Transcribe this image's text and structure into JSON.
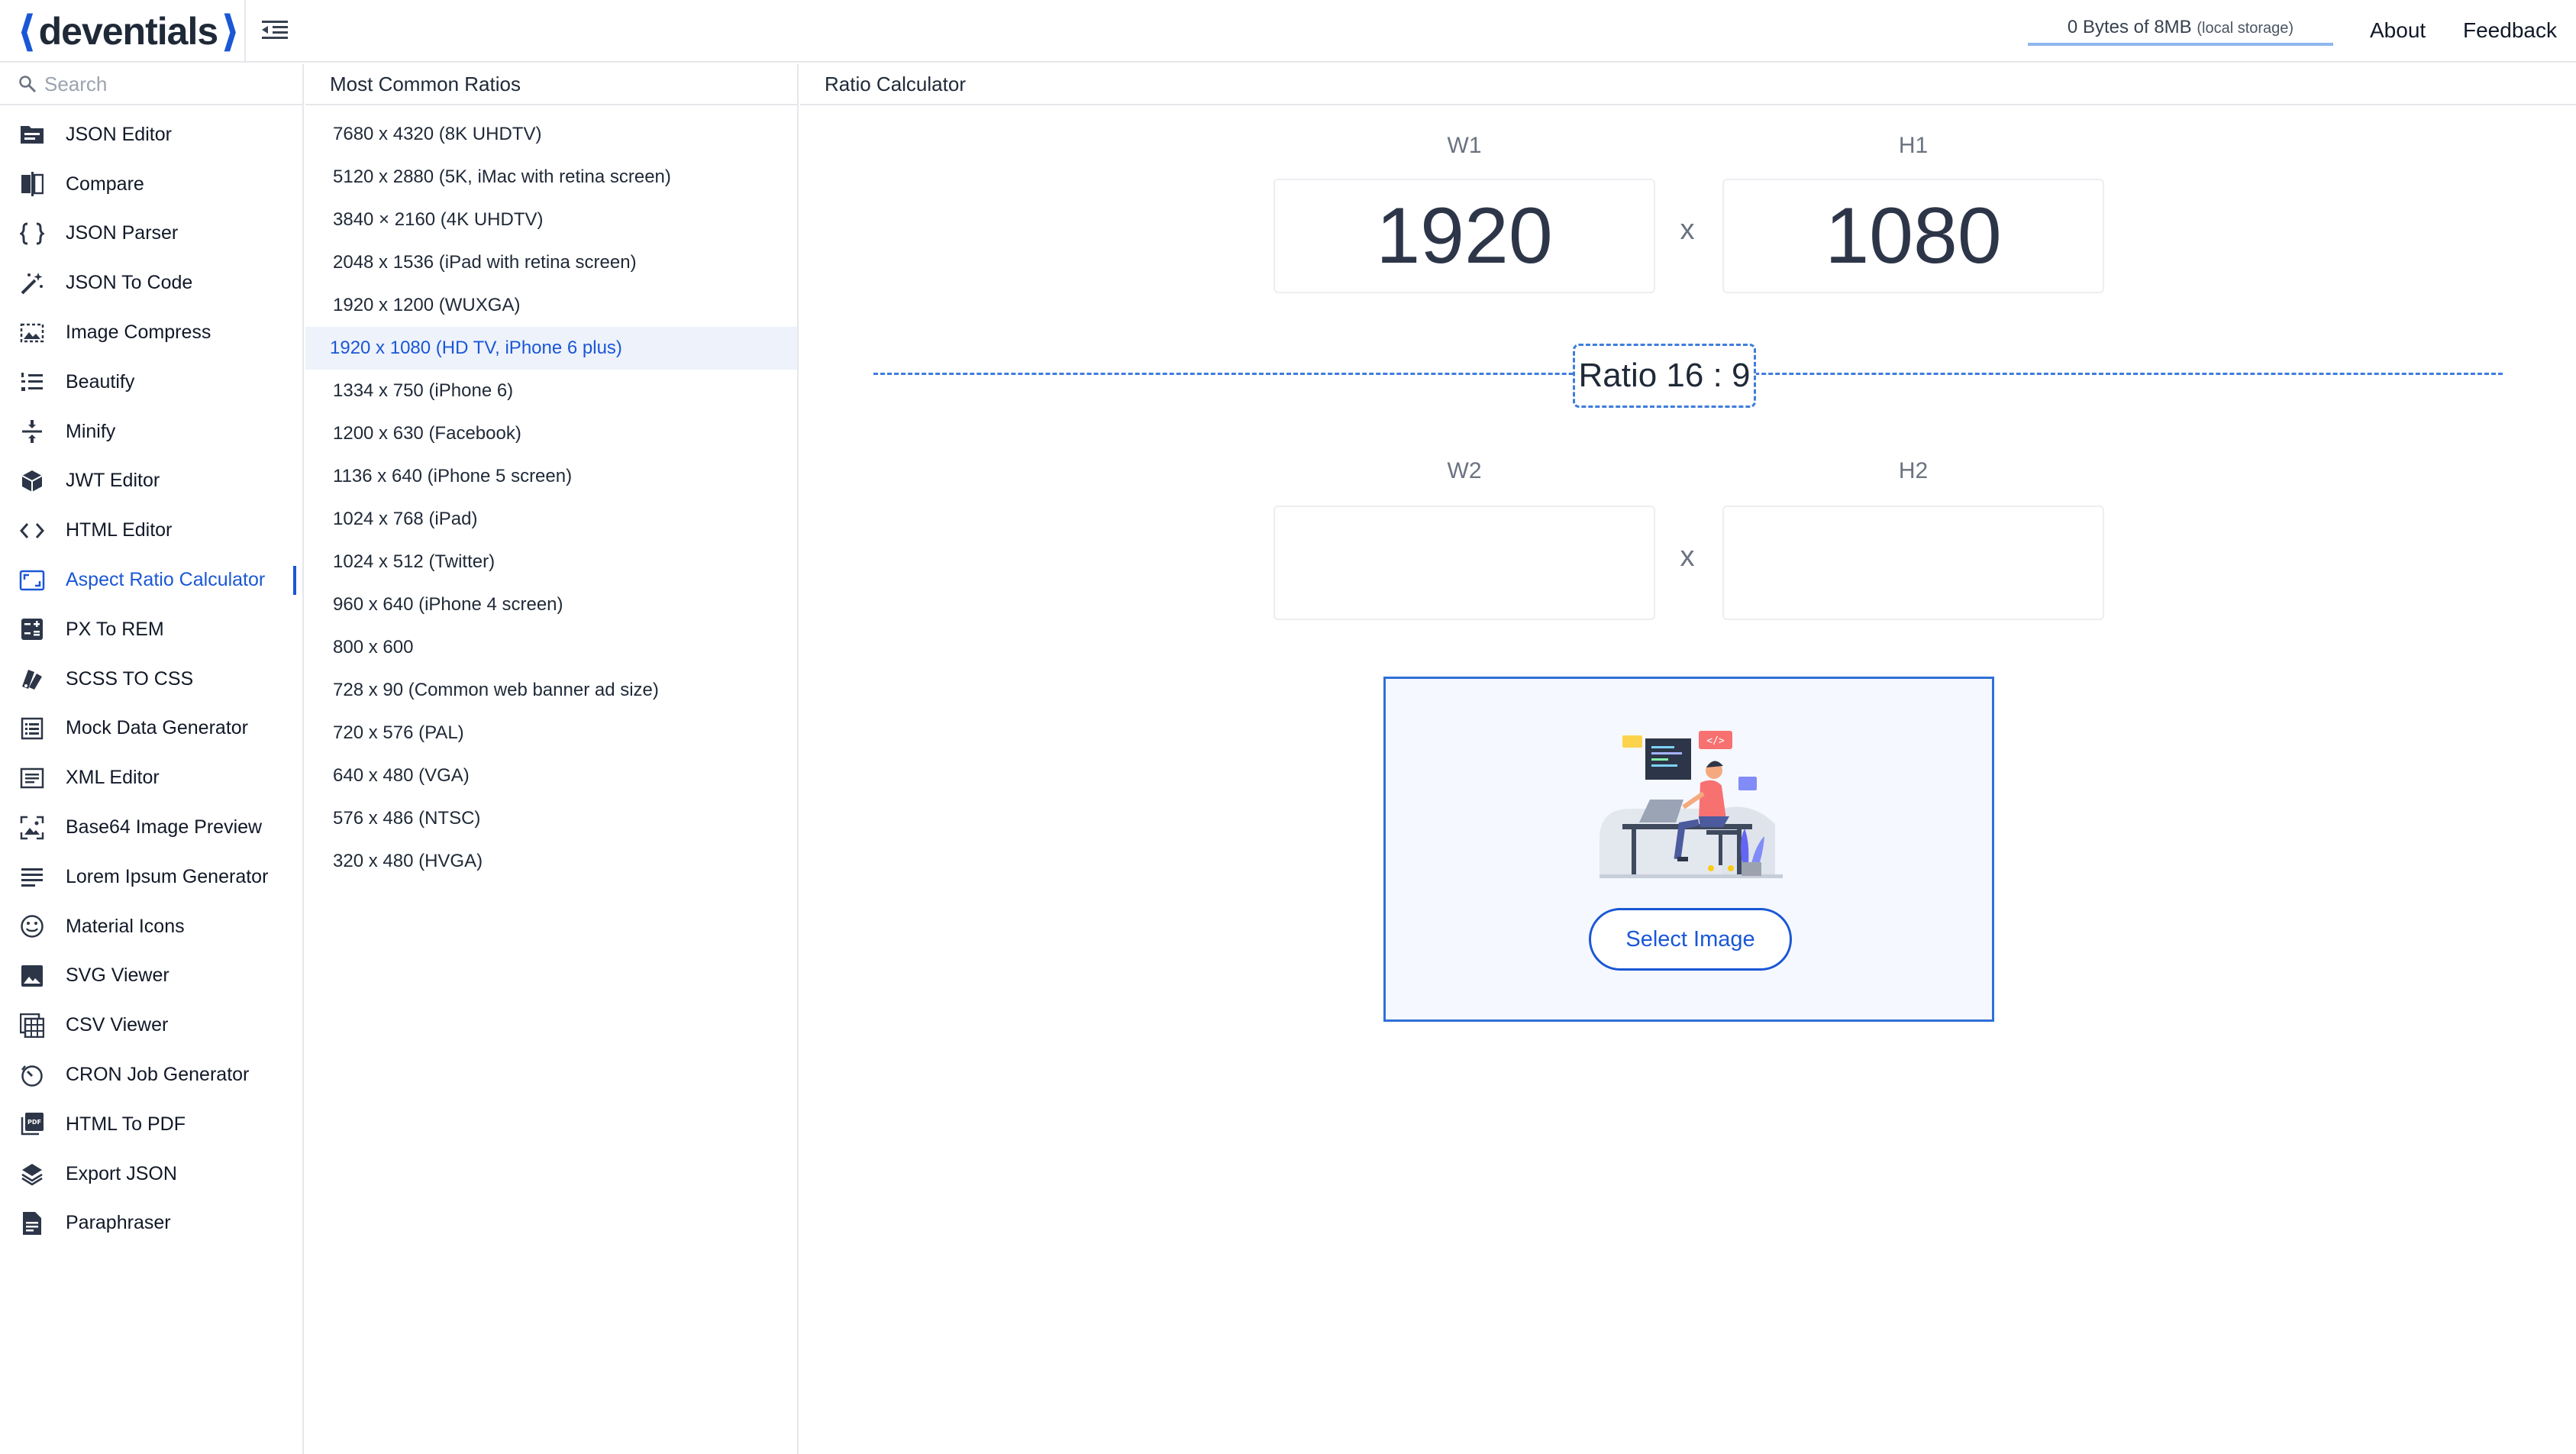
{
  "header": {
    "brand": "deventials",
    "storage_main": "0 Bytes of 8MB",
    "storage_note": "(local storage)",
    "about": "About",
    "feedback": "Feedback"
  },
  "sidebar": {
    "search_placeholder": "Search",
    "items": [
      {
        "label": "JSON Editor",
        "icon": "folder-icon"
      },
      {
        "label": "Compare",
        "icon": "compare-icon"
      },
      {
        "label": "JSON Parser",
        "icon": "braces-icon"
      },
      {
        "label": "JSON To Code",
        "icon": "magic-wand-icon"
      },
      {
        "label": "Image Compress",
        "icon": "image-compress-icon"
      },
      {
        "label": "Beautify",
        "icon": "numbered-list-icon"
      },
      {
        "label": "Minify",
        "icon": "compress-icon"
      },
      {
        "label": "JWT Editor",
        "icon": "cube-icon"
      },
      {
        "label": "HTML Editor",
        "icon": "code-icon"
      },
      {
        "label": "Aspect Ratio Calculator",
        "icon": "aspect-ratio-icon",
        "active": true
      },
      {
        "label": "PX To REM",
        "icon": "calculator-icon"
      },
      {
        "label": "SCSS TO CSS",
        "icon": "swatch-icon"
      },
      {
        "label": "Mock Data Generator",
        "icon": "list-doc-icon"
      },
      {
        "label": "XML Editor",
        "icon": "xml-list-icon"
      },
      {
        "label": "Base64 Image Preview",
        "icon": "image-preview-icon"
      },
      {
        "label": "Lorem Ipsum Generator",
        "icon": "text-lines-icon"
      },
      {
        "label": "Material Icons",
        "icon": "smiley-icon"
      },
      {
        "label": "SVG Viewer",
        "icon": "image-icon"
      },
      {
        "label": "CSV Viewer",
        "icon": "table-icon"
      },
      {
        "label": "CRON Job Generator",
        "icon": "timer-icon"
      },
      {
        "label": "HTML To PDF",
        "icon": "pdf-icon"
      },
      {
        "label": "Export JSON",
        "icon": "layers-icon"
      },
      {
        "label": "Paraphraser",
        "icon": "document-icon"
      }
    ]
  },
  "ratios": {
    "title": "Most Common Ratios",
    "items": [
      "7680 x 4320 (8K UHDTV)",
      "5120 x 2880 (5K, iMac with retina screen)",
      "3840 × 2160 (4K UHDTV)",
      "2048 x 1536 (iPad with retina screen)",
      "1920 x 1200 (WUXGA)",
      "1920 x 1080 (HD TV, iPhone 6 plus)",
      "1334 x 750 (iPhone 6)",
      "1200 x 630 (Facebook)",
      "1136 x 640 (iPhone 5 screen)",
      "1024 x 768 (iPad)",
      "1024 x 512 (Twitter)",
      "960 x 640 (iPhone 4 screen)",
      "800 x 600",
      "728 x 90 (Common web banner ad size)",
      "720 x 576 (PAL)",
      "640 x 480 (VGA)",
      "576 x 486 (NTSC)",
      "320 x 480 (HVGA)"
    ],
    "active_index": 5
  },
  "calculator": {
    "title": "Ratio Calculator",
    "w1_label": "W1",
    "h1_label": "H1",
    "w1_value": "1920",
    "h1_value": "1080",
    "w2_label": "W2",
    "h2_label": "H2",
    "w2_value": "",
    "h2_value": "",
    "times": "x",
    "ratio_text": "Ratio 16 : 9",
    "select_image": "Select Image"
  },
  "colors": {
    "accent": "#1a57d6",
    "dashed": "#3f7ddc",
    "active_bg": "#eef2fb"
  }
}
